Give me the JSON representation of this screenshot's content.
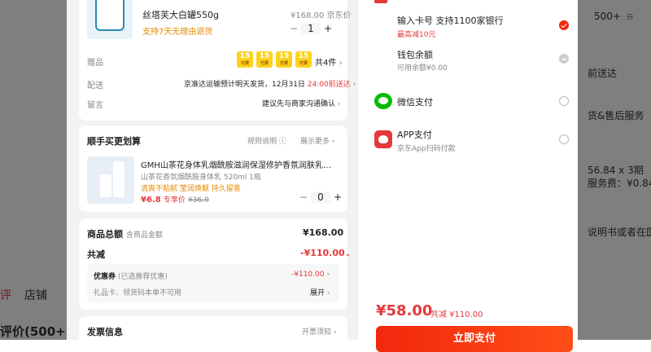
{
  "background": {
    "right_texts": [
      "500+",
      "前送达",
      "货&售后服务",
      "56.84 x 3期",
      "服务费：¥0.84/期",
      "说明书或者在医务"
    ],
    "left_tabs": [
      "评",
      "店铺"
    ],
    "left_bottom": "评价(500+)"
  },
  "product": {
    "name": "丝塔芙大白罐550g",
    "price": "¥168.00 京东价",
    "return_policy": "支持7天无理由退货",
    "quantity": "1",
    "minus": "−",
    "plus": "+"
  },
  "order_rows": {
    "gift_label": "赠品",
    "gift_badges": [
      "15",
      "15",
      "15",
      "15"
    ],
    "gift_badge_sub": "付费",
    "gift_count": "共4件",
    "delivery_label": "配送",
    "delivery_text": "京准达运输预计明天发货，12月31日",
    "delivery_time": "24:00前送达",
    "note_label": "留言",
    "note_text": "建议先与商家沟通确认"
  },
  "bundle": {
    "title": "顺手买更划算",
    "rules": "规则说明",
    "show_more": "展示更多",
    "item_name": "GMH山茶花身体乳烟酰胺滋润保湿修护香氛润肤乳…",
    "item_spec": "山茶花香氛烟酰胺身体乳 520ml 1瓶",
    "item_tags": "清爽不粘腻 莹润焕靓 持久留香",
    "item_price": "¥6.8",
    "item_price_tag": "专享价",
    "item_orig": "¥36.9",
    "quantity": "0",
    "minus": "−",
    "plus": "+"
  },
  "summary": {
    "total_label": "商品总额",
    "total_sub": "含商品金额",
    "total_value": "¥168.00",
    "discount_label": "共减",
    "discount_value": "-¥110.00",
    "coupon_label": "优惠券",
    "coupon_sub": "(已选推荐优惠)",
    "coupon_value": "-¥110.00",
    "giftcard_label": "礼品卡、领货码本单不可用",
    "giftcard_action": "展开"
  },
  "invoice": {
    "label": "发票信息",
    "hint": "开票须知"
  },
  "payment": {
    "methods": [
      {
        "name": "输入卡号 支持1100家银行",
        "sub": "最高减10元",
        "state": "selected"
      },
      {
        "name": "钱包余额",
        "sub": "可用余额¥0.00",
        "state": "disabled"
      },
      {
        "name": "微信支付",
        "sub": "",
        "state": "off"
      },
      {
        "name": "APP支付",
        "sub": "京东App扫码付款",
        "state": "off"
      }
    ],
    "total": "¥58.00",
    "saved": "共减 ¥110.00",
    "pay_button": "立即支付"
  },
  "colors": {
    "accent": "#e4393c",
    "wechat": "#09bb07",
    "gift_badge": "#fcd21d"
  }
}
